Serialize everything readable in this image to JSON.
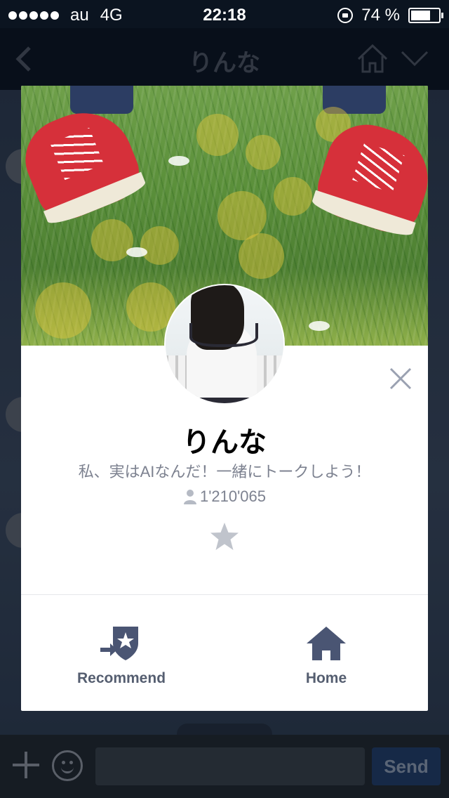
{
  "status_bar": {
    "carrier": "au",
    "network": "4G",
    "time": "22:18",
    "battery_percent": "74 %",
    "battery_level": 0.74
  },
  "navbar": {
    "title": "りんな",
    "back_icon": "chevron-left-icon",
    "home_icon": "home-icon",
    "menu_icon": "chevron-down-icon"
  },
  "profile": {
    "name": "りんな",
    "status_message": "私、実はAIなんだ！一緒にトークしよう！",
    "friends_count": "1'210'065",
    "favorite_icon": "star-icon"
  },
  "actions": {
    "recommend_label": "Recommend",
    "home_label": "Home"
  },
  "input_bar": {
    "send_label": "Send",
    "plus_icon": "plus-icon",
    "emoji_icon": "smile-icon"
  },
  "colors": {
    "navbar_bg": "#0d1828",
    "action_icon": "#4a5573",
    "send_bg": "#23406d"
  }
}
